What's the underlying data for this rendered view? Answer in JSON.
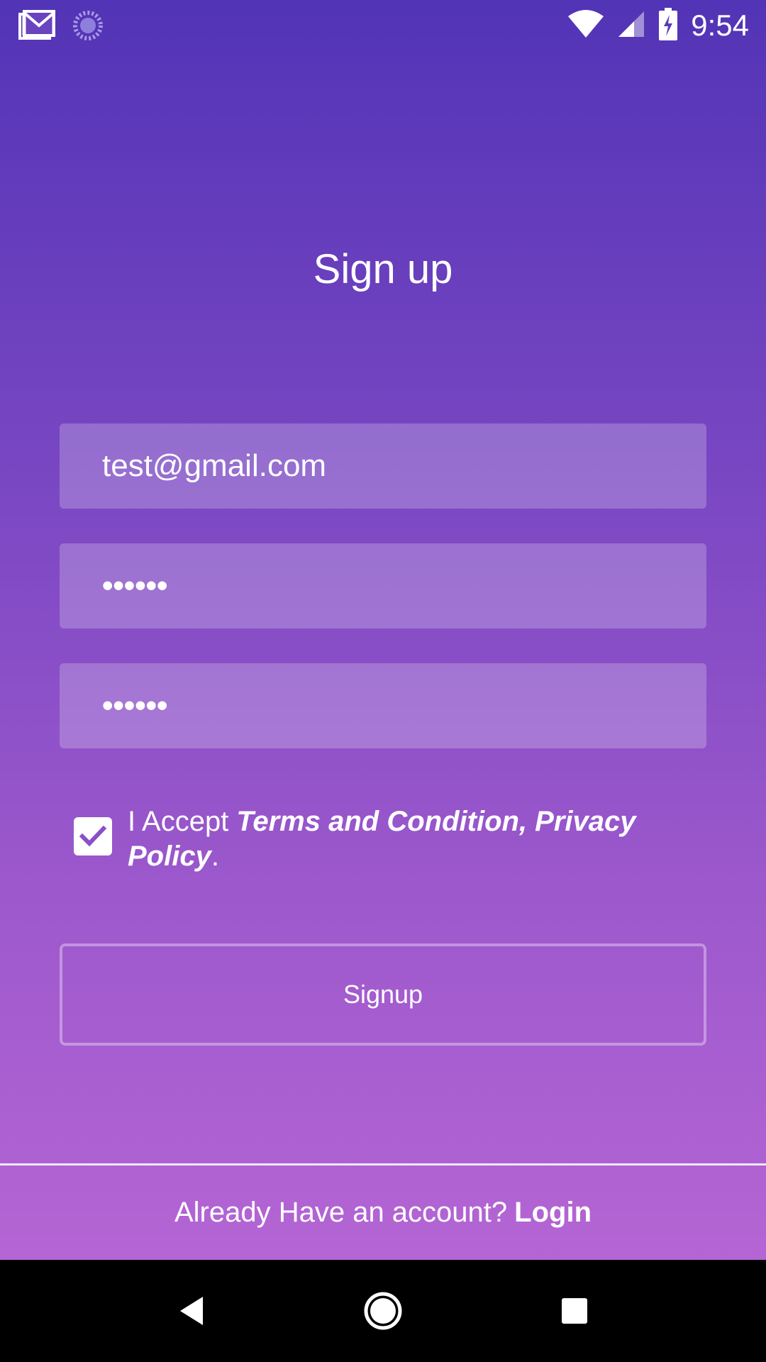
{
  "status_bar": {
    "time": "9:54",
    "left_icons": [
      "gmail-icon",
      "loading-icon"
    ],
    "right_icons": [
      "wifi-icon",
      "signal-icon",
      "battery-charging-icon"
    ]
  },
  "page": {
    "title": "Sign up"
  },
  "form": {
    "email_value": "test@gmail.com",
    "password_value": "••••••",
    "confirm_password_value": "••••••",
    "terms_checked": true,
    "terms_prefix": " I Accept ",
    "terms_links": "Terms and Condition, Privacy Policy",
    "terms_suffix": "."
  },
  "actions": {
    "signup_label": "Signup"
  },
  "footer": {
    "prompt": "Already Have an account?",
    "login_label": "Login"
  },
  "nav_bar": {
    "icons": [
      "back-icon",
      "home-icon",
      "recents-icon"
    ]
  },
  "colors": {
    "gradient_top": "#5234b6",
    "gradient_bottom": "#b565d4",
    "checkmark": "#8a4fc9"
  }
}
